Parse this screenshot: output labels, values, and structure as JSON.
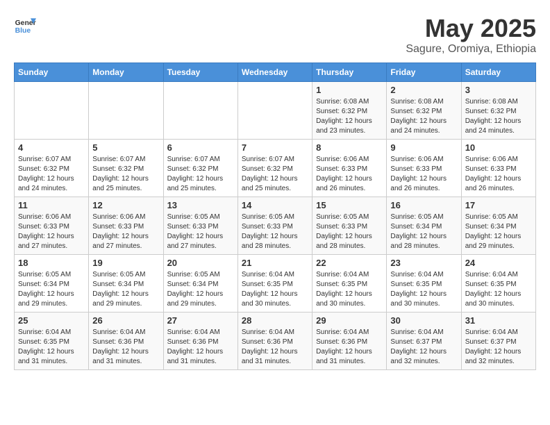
{
  "header": {
    "logo_line1": "General",
    "logo_line2": "Blue",
    "month_title": "May 2025",
    "subtitle": "Sagure, Oromiya, Ethiopia"
  },
  "days_of_week": [
    "Sunday",
    "Monday",
    "Tuesday",
    "Wednesday",
    "Thursday",
    "Friday",
    "Saturday"
  ],
  "weeks": [
    [
      {
        "day": "",
        "info": ""
      },
      {
        "day": "",
        "info": ""
      },
      {
        "day": "",
        "info": ""
      },
      {
        "day": "",
        "info": ""
      },
      {
        "day": "1",
        "info": "Sunrise: 6:08 AM\nSunset: 6:32 PM\nDaylight: 12 hours\nand 23 minutes."
      },
      {
        "day": "2",
        "info": "Sunrise: 6:08 AM\nSunset: 6:32 PM\nDaylight: 12 hours\nand 24 minutes."
      },
      {
        "day": "3",
        "info": "Sunrise: 6:08 AM\nSunset: 6:32 PM\nDaylight: 12 hours\nand 24 minutes."
      }
    ],
    [
      {
        "day": "4",
        "info": "Sunrise: 6:07 AM\nSunset: 6:32 PM\nDaylight: 12 hours\nand 24 minutes."
      },
      {
        "day": "5",
        "info": "Sunrise: 6:07 AM\nSunset: 6:32 PM\nDaylight: 12 hours\nand 25 minutes."
      },
      {
        "day": "6",
        "info": "Sunrise: 6:07 AM\nSunset: 6:32 PM\nDaylight: 12 hours\nand 25 minutes."
      },
      {
        "day": "7",
        "info": "Sunrise: 6:07 AM\nSunset: 6:32 PM\nDaylight: 12 hours\nand 25 minutes."
      },
      {
        "day": "8",
        "info": "Sunrise: 6:06 AM\nSunset: 6:33 PM\nDaylight: 12 hours\nand 26 minutes."
      },
      {
        "day": "9",
        "info": "Sunrise: 6:06 AM\nSunset: 6:33 PM\nDaylight: 12 hours\nand 26 minutes."
      },
      {
        "day": "10",
        "info": "Sunrise: 6:06 AM\nSunset: 6:33 PM\nDaylight: 12 hours\nand 26 minutes."
      }
    ],
    [
      {
        "day": "11",
        "info": "Sunrise: 6:06 AM\nSunset: 6:33 PM\nDaylight: 12 hours\nand 27 minutes."
      },
      {
        "day": "12",
        "info": "Sunrise: 6:06 AM\nSunset: 6:33 PM\nDaylight: 12 hours\nand 27 minutes."
      },
      {
        "day": "13",
        "info": "Sunrise: 6:05 AM\nSunset: 6:33 PM\nDaylight: 12 hours\nand 27 minutes."
      },
      {
        "day": "14",
        "info": "Sunrise: 6:05 AM\nSunset: 6:33 PM\nDaylight: 12 hours\nand 28 minutes."
      },
      {
        "day": "15",
        "info": "Sunrise: 6:05 AM\nSunset: 6:33 PM\nDaylight: 12 hours\nand 28 minutes."
      },
      {
        "day": "16",
        "info": "Sunrise: 6:05 AM\nSunset: 6:34 PM\nDaylight: 12 hours\nand 28 minutes."
      },
      {
        "day": "17",
        "info": "Sunrise: 6:05 AM\nSunset: 6:34 PM\nDaylight: 12 hours\nand 29 minutes."
      }
    ],
    [
      {
        "day": "18",
        "info": "Sunrise: 6:05 AM\nSunset: 6:34 PM\nDaylight: 12 hours\nand 29 minutes."
      },
      {
        "day": "19",
        "info": "Sunrise: 6:05 AM\nSunset: 6:34 PM\nDaylight: 12 hours\nand 29 minutes."
      },
      {
        "day": "20",
        "info": "Sunrise: 6:05 AM\nSunset: 6:34 PM\nDaylight: 12 hours\nand 29 minutes."
      },
      {
        "day": "21",
        "info": "Sunrise: 6:04 AM\nSunset: 6:35 PM\nDaylight: 12 hours\nand 30 minutes."
      },
      {
        "day": "22",
        "info": "Sunrise: 6:04 AM\nSunset: 6:35 PM\nDaylight: 12 hours\nand 30 minutes."
      },
      {
        "day": "23",
        "info": "Sunrise: 6:04 AM\nSunset: 6:35 PM\nDaylight: 12 hours\nand 30 minutes."
      },
      {
        "day": "24",
        "info": "Sunrise: 6:04 AM\nSunset: 6:35 PM\nDaylight: 12 hours\nand 30 minutes."
      }
    ],
    [
      {
        "day": "25",
        "info": "Sunrise: 6:04 AM\nSunset: 6:35 PM\nDaylight: 12 hours\nand 31 minutes."
      },
      {
        "day": "26",
        "info": "Sunrise: 6:04 AM\nSunset: 6:36 PM\nDaylight: 12 hours\nand 31 minutes."
      },
      {
        "day": "27",
        "info": "Sunrise: 6:04 AM\nSunset: 6:36 PM\nDaylight: 12 hours\nand 31 minutes."
      },
      {
        "day": "28",
        "info": "Sunrise: 6:04 AM\nSunset: 6:36 PM\nDaylight: 12 hours\nand 31 minutes."
      },
      {
        "day": "29",
        "info": "Sunrise: 6:04 AM\nSunset: 6:36 PM\nDaylight: 12 hours\nand 31 minutes."
      },
      {
        "day": "30",
        "info": "Sunrise: 6:04 AM\nSunset: 6:37 PM\nDaylight: 12 hours\nand 32 minutes."
      },
      {
        "day": "31",
        "info": "Sunrise: 6:04 AM\nSunset: 6:37 PM\nDaylight: 12 hours\nand 32 minutes."
      }
    ]
  ]
}
